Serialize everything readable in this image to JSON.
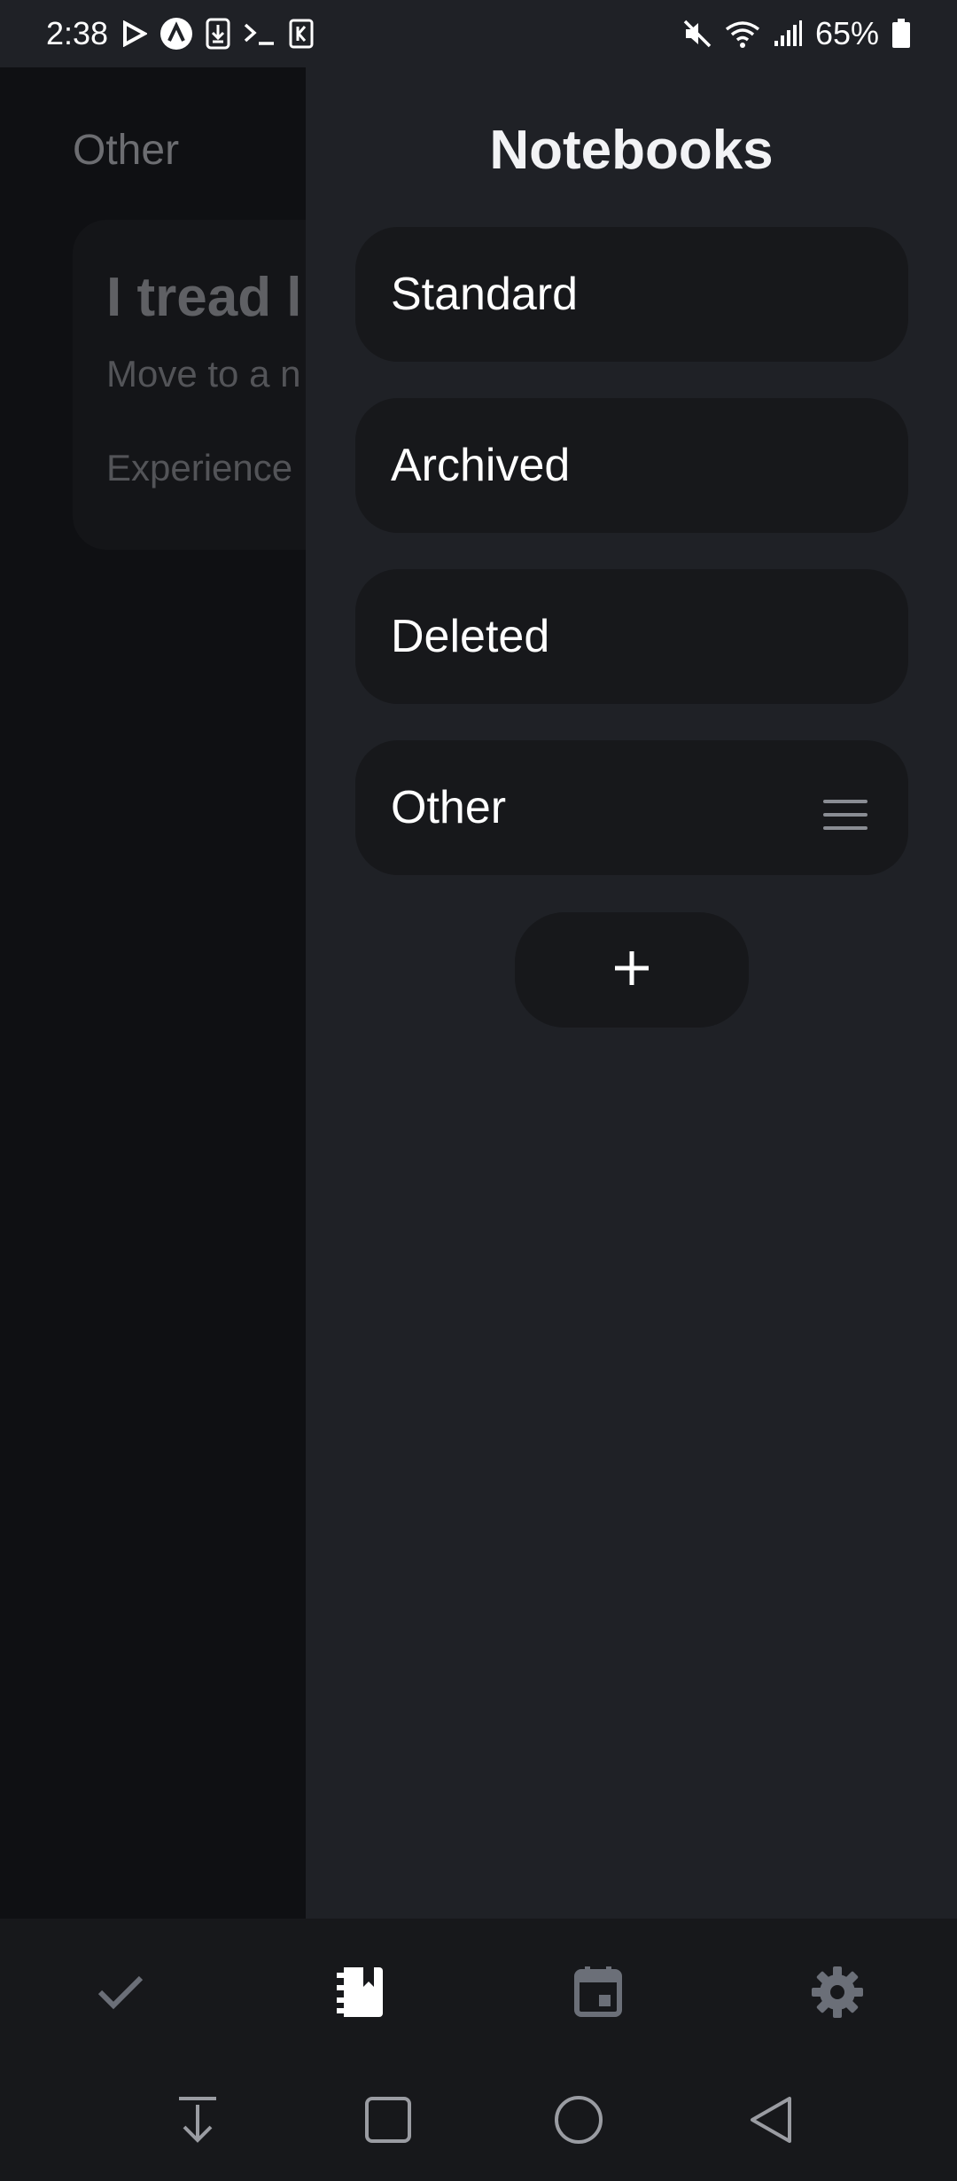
{
  "status_bar": {
    "time": "2:38",
    "battery": "65%",
    "icons_left": [
      "play-store-icon",
      "app-a-icon",
      "download-icon",
      "terminal-icon",
      "app-k-icon"
    ],
    "icons_right": [
      "mute-icon",
      "wifi-icon",
      "signal-icon",
      "battery-icon"
    ]
  },
  "background_list": {
    "heading": "Other",
    "card": {
      "title": "I tread l",
      "line1": "Move to a n",
      "line2": "Experience"
    }
  },
  "drawer": {
    "title": "Notebooks",
    "notebooks": [
      {
        "label": "Standard"
      },
      {
        "label": "Archived"
      },
      {
        "label": "Deleted"
      },
      {
        "label": "Other",
        "has_menu": true
      }
    ],
    "add_button_icon": "plus-icon"
  },
  "tab_bar": {
    "tabs": [
      {
        "icon": "checkmark-icon",
        "active": false
      },
      {
        "icon": "notebook-icon",
        "active": true
      },
      {
        "icon": "calendar-icon",
        "active": false
      },
      {
        "icon": "gear-icon",
        "active": false
      }
    ]
  },
  "system_nav": [
    "download-arrow-icon",
    "recents-square-icon",
    "home-circle-icon",
    "back-triangle-icon"
  ],
  "colors": {
    "background": "#0f1013",
    "drawer": "#1f2126",
    "item": "#17181b",
    "icon_inactive": "#6b6f78",
    "icon_active": "#ffffff"
  }
}
